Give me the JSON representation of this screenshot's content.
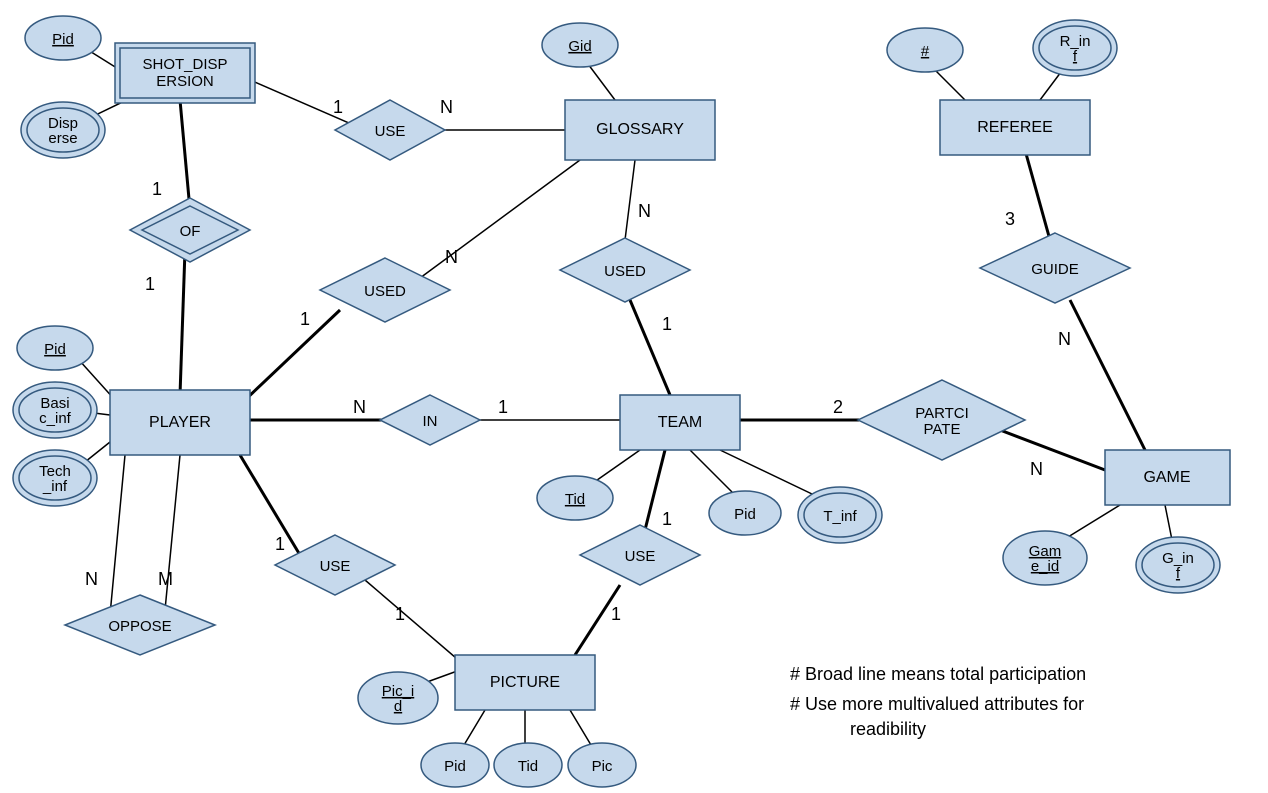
{
  "entities": {
    "shot_dispersion": "SHOT_DISPERSION",
    "glossary": "GLOSSARY",
    "referee": "REFEREE",
    "player": "PLAYER",
    "team": "TEAM",
    "game": "GAME",
    "picture": "PICTURE"
  },
  "relationships": {
    "use_sd": "USE",
    "of": "OF",
    "used_pg": "USED",
    "used_tg": "USED",
    "in": "IN",
    "guide": "GUIDE",
    "participate": "PARTCIPATE",
    "oppose": "OPPOSE",
    "use_pp": "USE",
    "use_tp": "USE"
  },
  "attributes": {
    "sd_pid": "Pid",
    "disperse": "Disperse",
    "gid": "Gid",
    "ref_num": "#",
    "r_inf": "R_inf",
    "p_pid": "Pid",
    "basic_inf": "Basic_inf",
    "tech_inf": "Tech_inf",
    "tid": "Tid",
    "t_pid": "Pid",
    "t_inf": "T_inf",
    "game_id": "Game_id",
    "g_inf": "G_inf",
    "pic_id": "Pic_id",
    "pic_pid": "Pid",
    "pic_tid": "Tid",
    "pic": "Pic"
  },
  "cardinalities": {
    "sd_use": "1",
    "gl_use": "N",
    "sd_of": "1",
    "pl_of": "1",
    "pl_used": "1",
    "gl_used_p": "N",
    "gl_used_t": "N",
    "tm_used": "1",
    "pl_in": "N",
    "tm_in": "1",
    "tm_part": "2",
    "gm_part": "N",
    "ref_guide": "3",
    "gm_guide": "N",
    "pl_use_pic": "1",
    "pic_use_pl": "1",
    "tm_use_pic": "1",
    "pic_use_tm": "1",
    "pl_opp_n": "N",
    "pl_opp_m": "M"
  },
  "notes": {
    "line1": "# Broad line means  total participation",
    "line2": "# Use more multivalued attributes for",
    "line3": "readibility"
  }
}
